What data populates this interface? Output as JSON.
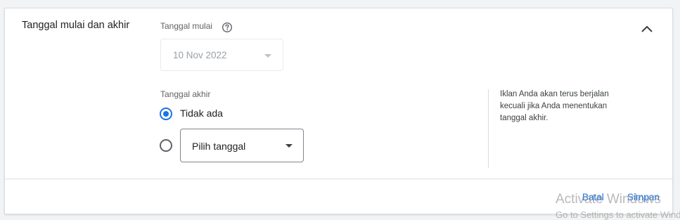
{
  "section": {
    "title": "Tanggal mulai dan akhir"
  },
  "start": {
    "label": "Tanggal mulai",
    "value": "10 Nov 2022"
  },
  "end": {
    "label": "Tanggal akhir",
    "option_none": "Tidak ada",
    "option_pick_placeholder": "Pilih tanggal",
    "selected": "Tidak ada"
  },
  "hint": {
    "text": "Iklan Anda akan terus berjalan kecuali jika Anda menentukan tanggal akhir."
  },
  "actions": {
    "cancel": "Batal",
    "save": "Simpan"
  },
  "watermark": {
    "title": "Activate Windows",
    "subtitle": "Go to Settings to activate Windows."
  },
  "icons": {
    "collapse": "chevron-up-icon",
    "help": "help-circle-icon",
    "dropdown": "caret-down-icon"
  },
  "colors": {
    "accent": "#1a73e8",
    "text": "#202124",
    "muted": "#5f6368",
    "border": "#dadce0"
  }
}
